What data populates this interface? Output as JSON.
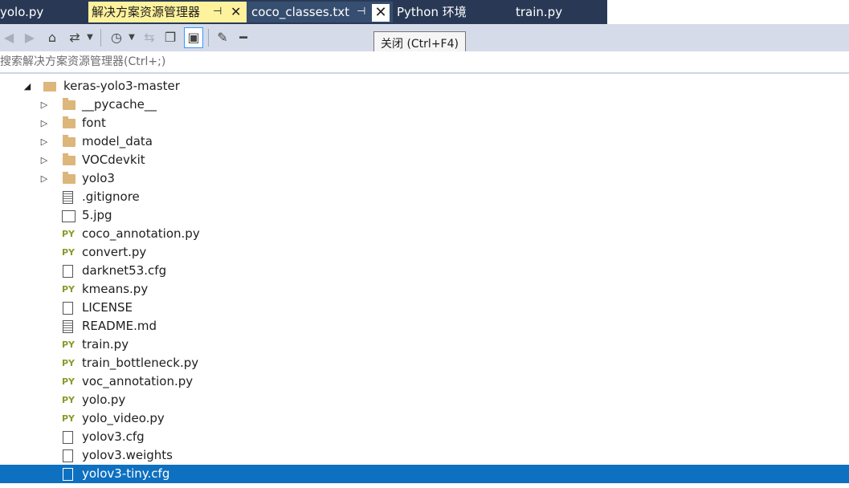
{
  "tabs": [
    {
      "label": "yolo.py"
    },
    {
      "label": "解决方案资源管理器",
      "pin": "⊣",
      "close": "✕"
    },
    {
      "label": "coco_classes.txt",
      "pin": "⊣",
      "close": "✕"
    },
    {
      "label": "Python 环境"
    },
    {
      "label": "train.py"
    }
  ],
  "tooltip": "关闭 (Ctrl+F4)",
  "toolbar": {
    "icons": [
      "back-icon",
      "forward-icon",
      "home-icon",
      "switch-views-icon",
      "history-icon",
      "sync-icon",
      "collapse-icon",
      "show-all-files-icon",
      "properties-icon",
      "preview-icon"
    ]
  },
  "search": {
    "placeholder": "搜索解决方案资源管理器(Ctrl+;)"
  },
  "tree": {
    "root": {
      "label": "keras-yolo3-master",
      "expanded": true
    },
    "items": [
      {
        "label": "__pycache__",
        "kind": "folder",
        "expandable": true
      },
      {
        "label": "font",
        "kind": "folder",
        "expandable": true
      },
      {
        "label": "model_data",
        "kind": "folder",
        "expandable": true
      },
      {
        "label": "VOCdevkit",
        "kind": "folder",
        "expandable": true
      },
      {
        "label": "yolo3",
        "kind": "folder",
        "expandable": true
      },
      {
        "label": ".gitignore",
        "kind": "text"
      },
      {
        "label": "5.jpg",
        "kind": "image"
      },
      {
        "label": "coco_annotation.py",
        "kind": "py"
      },
      {
        "label": "convert.py",
        "kind": "py"
      },
      {
        "label": "darknet53.cfg",
        "kind": "file"
      },
      {
        "label": "kmeans.py",
        "kind": "py"
      },
      {
        "label": "LICENSE",
        "kind": "file"
      },
      {
        "label": "README.md",
        "kind": "text"
      },
      {
        "label": "train.py",
        "kind": "py"
      },
      {
        "label": "train_bottleneck.py",
        "kind": "py"
      },
      {
        "label": "voc_annotation.py",
        "kind": "py"
      },
      {
        "label": "yolo.py",
        "kind": "py"
      },
      {
        "label": "yolo_video.py",
        "kind": "py"
      },
      {
        "label": "yolov3.cfg",
        "kind": "file"
      },
      {
        "label": "yolov3.weights",
        "kind": "file"
      },
      {
        "label": "yolov3-tiny.cfg",
        "kind": "file",
        "selected": true
      }
    ],
    "py_badge": "PY"
  }
}
